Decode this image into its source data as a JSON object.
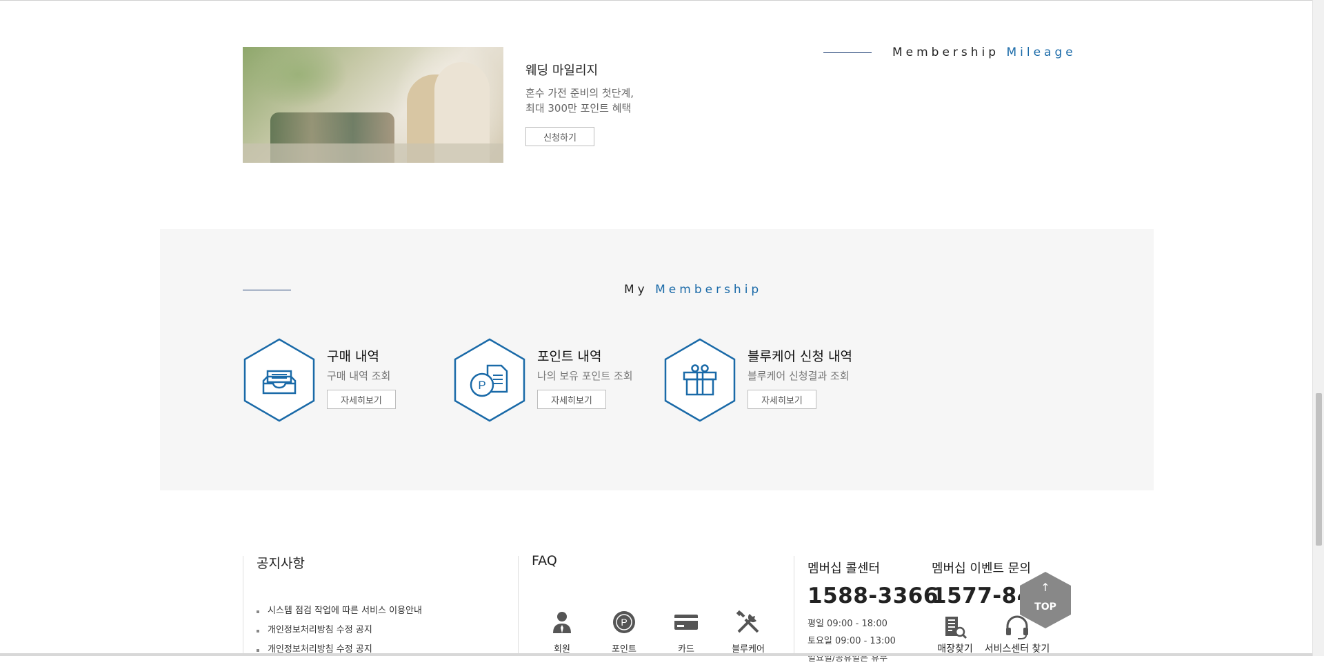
{
  "mileage": {
    "title_main": "Membership",
    "title_accent": "Mileage",
    "wedding": {
      "title": "웨딩 마일리지",
      "desc_line1": "혼수 가전 준비의 첫단계,",
      "desc_line2": "최대 300만 포인트 혜택",
      "button": "신청하기"
    }
  },
  "my_membership": {
    "title_main": "My",
    "title_accent": "Membership",
    "items": [
      {
        "title": "구매 내역",
        "subtitle": "구매 내역 조회",
        "button": "자세히보기",
        "icon": "inbox-icon"
      },
      {
        "title": "포인트 내역",
        "subtitle": "나의 보유 포인트 조회",
        "button": "자세히보기",
        "icon": "point-document-icon"
      },
      {
        "title": "블루케어 신청 내역",
        "subtitle": "블루케어 신청결과 조회",
        "button": "자세히보기",
        "icon": "gift-icon"
      }
    ]
  },
  "notice": {
    "title": "공지사항",
    "items": [
      "시스템 점검 작업에 따른 서비스 이용안내",
      "개인정보처리방침 수정 공지",
      "개인정보처리방침 수정 공지"
    ]
  },
  "faq": {
    "title": "FAQ",
    "items": [
      {
        "label": "회원",
        "icon": "member-icon"
      },
      {
        "label": "포인트",
        "icon": "point-icon"
      },
      {
        "label": "카드",
        "icon": "card-icon"
      },
      {
        "label": "블루케어",
        "icon": "tools-icon"
      }
    ]
  },
  "contact": {
    "center_title": "멤버십 콜센터",
    "center_phone": "1588-3366",
    "hours_weekday": "평일 09:00 - 18:00",
    "hours_saturday": "토요일 09:00 - 13:00",
    "hours_holiday": "일요일/공휴일은 휴무",
    "event_title": "멤버십 이벤트 문의",
    "event_phone": "1577-8433"
  },
  "utilities": [
    {
      "label": "매장찾기",
      "icon": "store-search-icon"
    },
    {
      "label": "서비스센터 찾기",
      "icon": "headset-icon"
    }
  ],
  "top_button": {
    "arrow": "↑",
    "label": "TOP"
  },
  "colors": {
    "accent": "#1a6aa8",
    "panel_bg": "#f6f6f6",
    "top_button": "#888888"
  }
}
